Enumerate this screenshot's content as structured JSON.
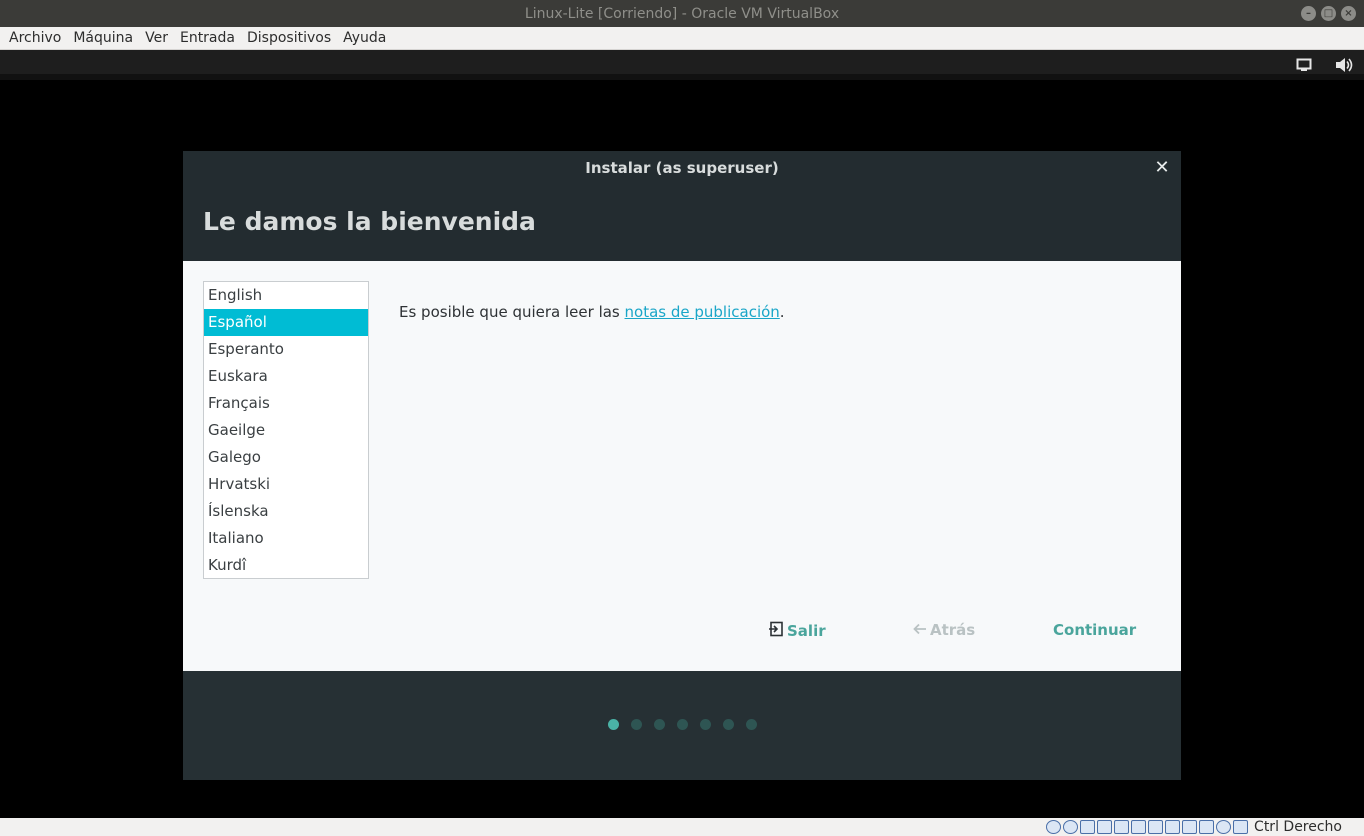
{
  "window": {
    "title": "Linux-Lite [Corriendo] - Oracle VM VirtualBox"
  },
  "menubar": {
    "items": [
      "Archivo",
      "Máquina",
      "Ver",
      "Entrada",
      "Dispositivos",
      "Ayuda"
    ]
  },
  "guest_panel": {
    "icons": [
      "display-icon",
      "volume-icon"
    ]
  },
  "dialog": {
    "title": "Instalar (as superuser)",
    "heading": "Le damos la bienvenida",
    "languages": [
      "English",
      "Español",
      "Esperanto",
      "Euskara",
      "Français",
      "Gaeilge",
      "Galego",
      "Hrvatski",
      "Íslenska",
      "Italiano",
      "Kurdî"
    ],
    "selected_language": "Español",
    "notes_prefix": "Es posible que quiera leer las ",
    "notes_link": "notas de publicación",
    "notes_suffix": ".",
    "buttons": {
      "quit": "Salir",
      "back": "Atrás",
      "continue": "Continuar"
    },
    "progress": {
      "steps": 7,
      "current": 1
    },
    "colors": {
      "accent": "#00bcd4",
      "button": "#4aa59c",
      "dot_active": "#4ab2a6",
      "dot_inactive": "#2e5553"
    }
  },
  "statusbar": {
    "host_key": "Ctrl Derecho"
  }
}
